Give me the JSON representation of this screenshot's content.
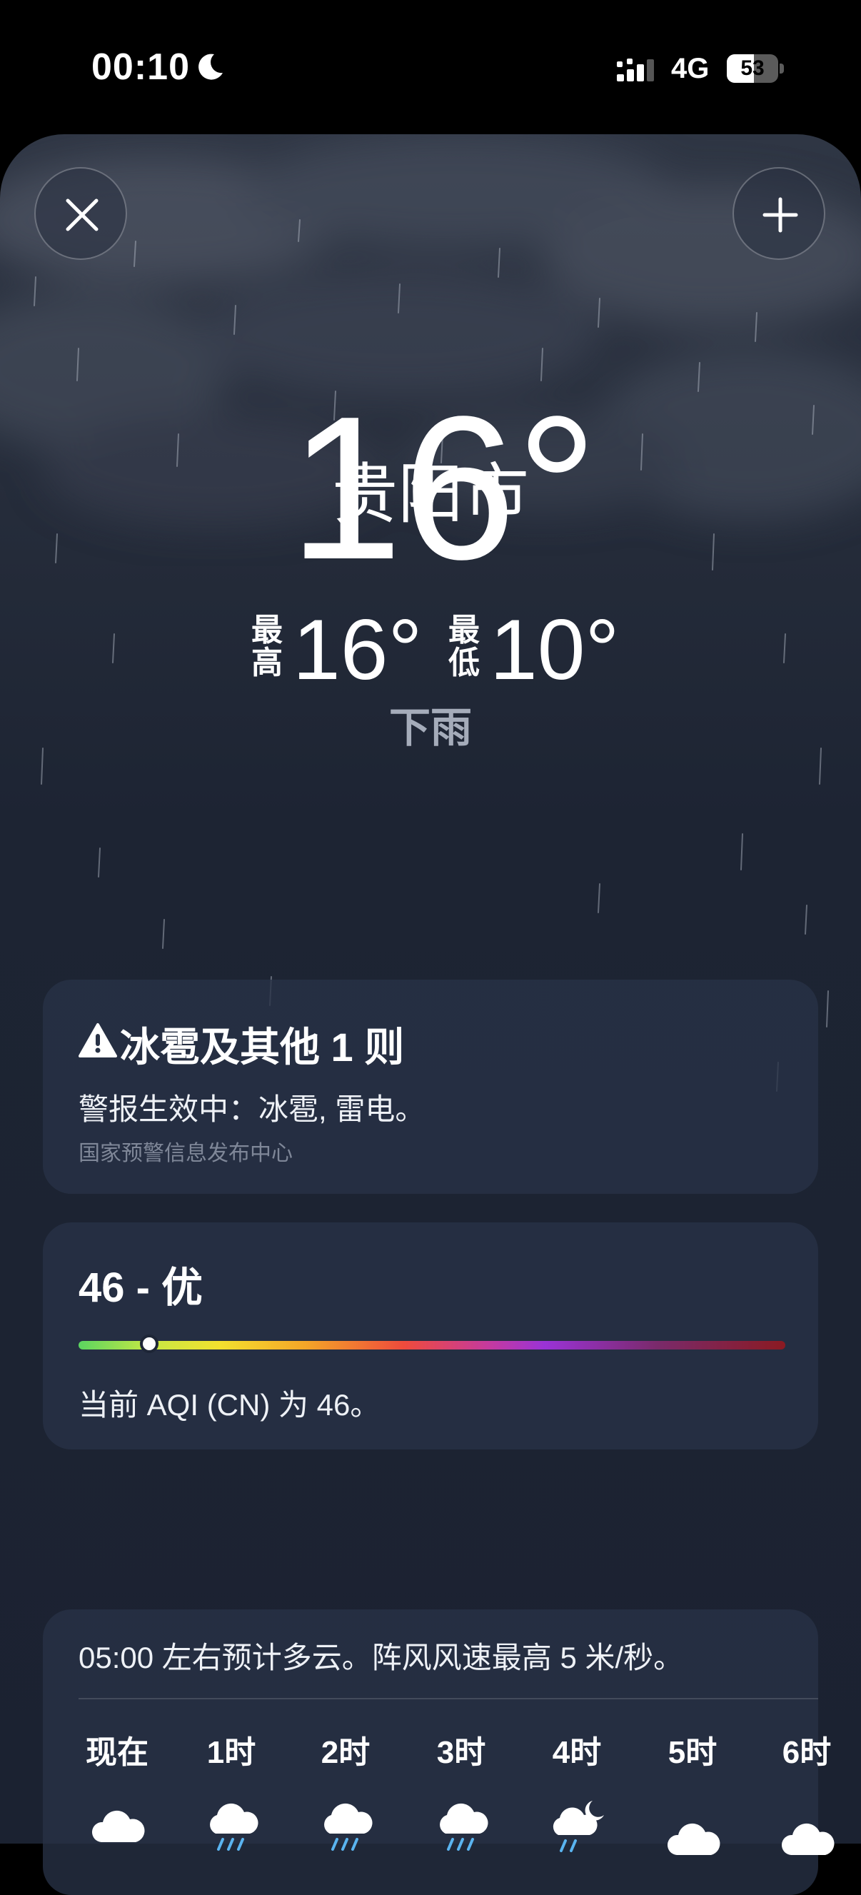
{
  "status_bar": {
    "time": "00:10",
    "moon_icon": "moon-icon",
    "network": "4G",
    "battery_level": "53",
    "battery_fraction": 0.53
  },
  "header": {
    "close_icon": "close-icon",
    "add_icon": "plus-icon"
  },
  "weather": {
    "city": "贵阳市",
    "temperature": "16°",
    "high_label": "最高",
    "high_value": "16°",
    "low_label": "最低",
    "low_value": "10°",
    "condition": "下雨"
  },
  "alert": {
    "icon": "warning-icon",
    "title": "冰雹及其他 1 则",
    "body": "警报生效中：冰雹, 雷电。",
    "source": "国家预警信息发布中心"
  },
  "aqi": {
    "value_text": "46 - 优",
    "description": "当前 AQI (CN) 为 46。",
    "marker_fraction": 0.1
  },
  "hourly": {
    "summary": "05:00 左右预计多云。阵风风速最高 5 米/秒。",
    "hours": [
      {
        "label": "现在",
        "icon": "cloud-icon"
      },
      {
        "label": "1时",
        "icon": "cloud-rain-icon"
      },
      {
        "label": "2时",
        "icon": "cloud-rain-icon"
      },
      {
        "label": "3时",
        "icon": "cloud-rain-icon"
      },
      {
        "label": "4时",
        "icon": "cloud-moon-rain-icon"
      },
      {
        "label": "5时",
        "icon": "cloud-icon"
      },
      {
        "label": "6时",
        "icon": "cloud-icon"
      }
    ]
  },
  "colors": {
    "background_top": "#2f3644",
    "background_bottom": "#1b2231",
    "card": "#283246",
    "condition_text": "#a5acba",
    "rain_icon": "#5ab4f0"
  }
}
